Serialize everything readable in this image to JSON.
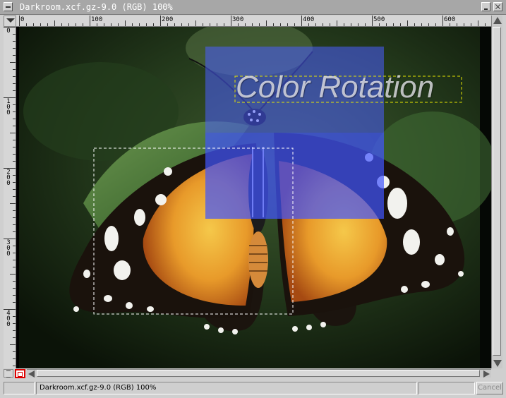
{
  "window": {
    "title": "Darkroom.xcf.gz-9.0 (RGB) 100%"
  },
  "rulers": {
    "horizontal": [
      {
        "label": "0",
        "value": 0
      },
      {
        "label": "100",
        "value": 100
      },
      {
        "label": "200",
        "value": 200
      },
      {
        "label": "300",
        "value": 300
      },
      {
        "label": "400",
        "value": 400
      },
      {
        "label": "500",
        "value": 500
      },
      {
        "label": "600",
        "value": 600
      }
    ],
    "vertical": [
      {
        "label": "0",
        "value": 0
      },
      {
        "label": "100",
        "value": 100
      },
      {
        "label": "200",
        "value": 200
      },
      {
        "label": "300",
        "value": 300
      },
      {
        "label": "400",
        "value": 400
      }
    ]
  },
  "canvas": {
    "overlay_text": "Color Rotation",
    "highlight_color": "#4a5cff"
  },
  "statusbar": {
    "text": "Darkroom.xcf.gz-9.0 (RGB) 100%",
    "cancel_label": "Cancel"
  }
}
